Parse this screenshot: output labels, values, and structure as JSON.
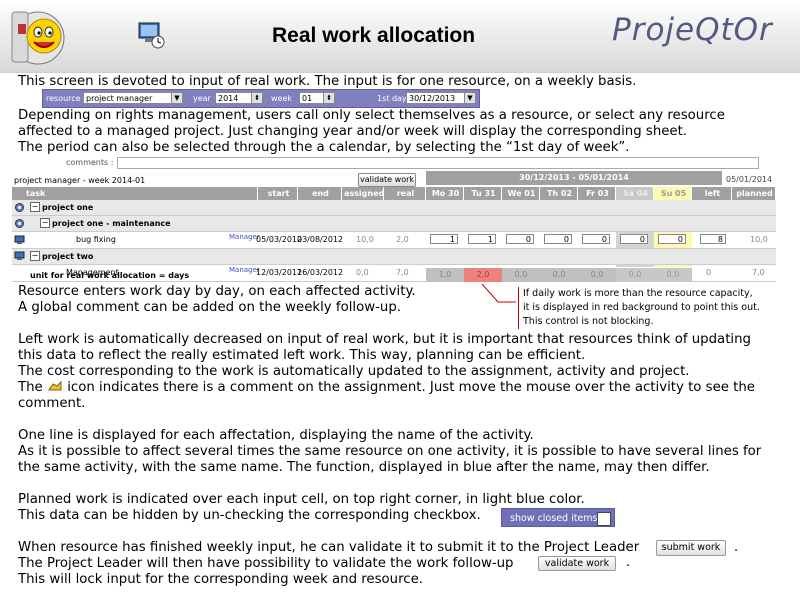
{
  "header": {
    "title": "Real work allocation",
    "brand": "ProjeQtOr"
  },
  "text": {
    "p1": "This screen is devoted to input of real work. The input is for one resource, on a weekly basis.",
    "p2a": "Depending on rights management, users call only select themselves as a resource, or select any resource",
    "p2b": "affected to a managed project. Just changing year and/or week will display the corresponding sheet.",
    "p2c": "The period can also be selected through the a calendar, by selecting the “1st day of week”.",
    "p3a": "Resource enters work day by day, on each affected activity.",
    "p3b": "A global comment can be added on the weekly follow-up.",
    "p4a": "Left work is automatically decreased on input of real work, but it is important that resources think of updating",
    "p4b": "this data to reflect the really estimated left work. This way, planning can be efficient.",
    "p4c": "The cost corresponding to the work is automatically updated to the assignment, activity and project.",
    "p4d_pre": "The",
    "p4d_post": "icon indicates there is a comment on the assignment. Just move the mouse over the activity to see the",
    "p4e": "comment.",
    "p5a": "One line is displayed for each affectation, displaying the name of the activity.",
    "p5b": "As it is possible to affect several times the same resource on one activity, it is possible to have several lines for",
    "p5c": "the same activity, with the same name. The function, displayed in blue after the name, may then differ.",
    "p6a": "Planned work is indicated over each input cell, on top right corner, in light blue color.",
    "p6b": "This data can be hidden by un-checking the corresponding checkbox.",
    "p7a": "When resource has finished weekly input, he can validate it to submit it to the Project Leader",
    "p7b": "The Project Leader will then have possibility to validate the work follow-up",
    "p7c": "This will lock input for the corresponding week and resource."
  },
  "selector": {
    "resource_label": "resource",
    "resource_value": "project manager",
    "year_label": "year",
    "year_value": "2014",
    "week_label": "week",
    "week_value": "01",
    "firstday_label": "1st day",
    "firstday_value": "30/12/2013"
  },
  "grid": {
    "comments_label": "comments :",
    "sheet_title": "project manager - week 2014-01",
    "validate_label": "validate work",
    "week_range": "30/12/2013 - 05/01/2014",
    "week_end_date": "05/01/2014",
    "columns": [
      "task",
      "start",
      "end",
      "assigned",
      "real",
      "Mo 30",
      "Tu 31",
      "We 01",
      "Th 02",
      "Fr 03",
      "Sa 04",
      "Su 05",
      "left",
      "planned"
    ],
    "rows": {
      "r1": "project one",
      "r2": "project one - maintenance",
      "r3_name": "bug fixing",
      "r3_func": "Manager",
      "r3_start": "05/03/2012",
      "r3_end": "03/08/2012",
      "r3_assigned": "10,0",
      "r3_real": "2,0",
      "r3_cells": [
        "1",
        "1",
        "0",
        "0",
        "0",
        "0",
        "0"
      ],
      "r3_left": "8",
      "r3_planned": "10,0",
      "r4": "project two",
      "r5_name": "Management",
      "r5_func": "Manager",
      "r5_start": "12/03/2012",
      "r5_end": "16/03/2012",
      "r5_assigned": "0,0",
      "r5_real": "7,0",
      "r5_cells": [
        "0",
        "0",
        "0",
        "0",
        "0",
        "0",
        "0"
      ],
      "r5_left": "0",
      "r5_planned": "7,0"
    },
    "unit_label": "unit for real work allocation = days",
    "totals": [
      "1,0",
      "2,0",
      "0,0",
      "0,0",
      "0,0",
      "0,0",
      "0,0"
    ]
  },
  "note": {
    "l1": "If daily work is more than the resource capacity,",
    "l2": "it is displayed in red background to point this out.",
    "l3": "This control is not blocking."
  },
  "buttons": {
    "show_closed": "show closed items",
    "submit_work": "submit work",
    "validate_work": "validate work"
  },
  "colors": {
    "accent": "#8080c0",
    "header_gray": "#a0a0a0",
    "weekend": "#c8c8c8",
    "today": "#fff8b0",
    "over_capacity": "#f08080",
    "brand": "#555a80"
  }
}
